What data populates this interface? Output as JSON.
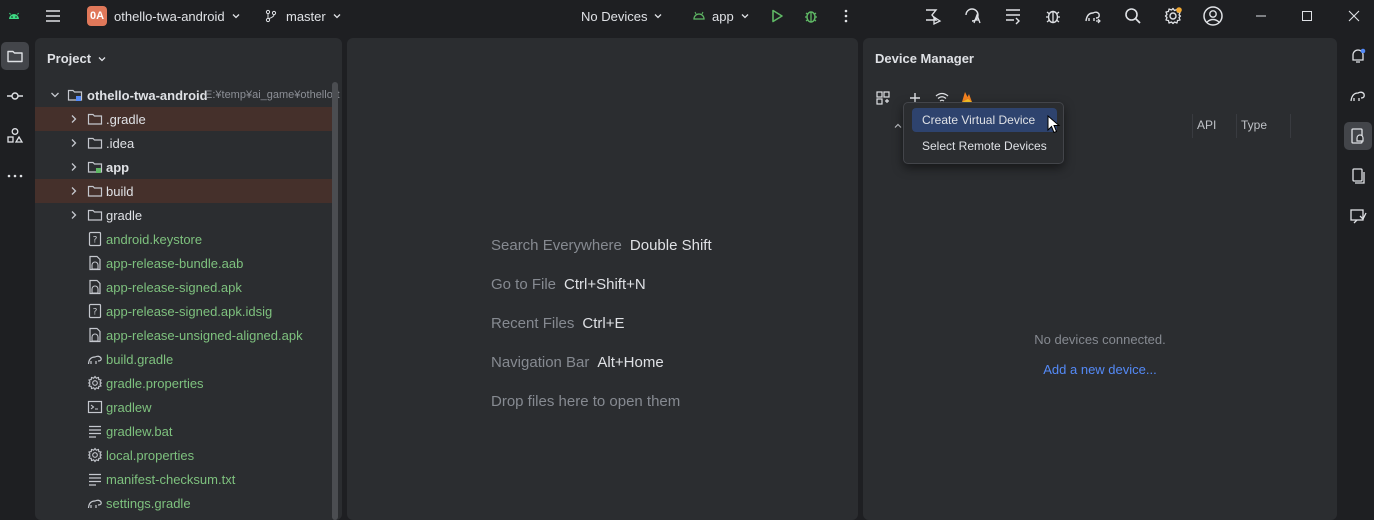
{
  "titlebar": {
    "project_badge": "0A",
    "project_name": "othello-twa-android",
    "branch": "master",
    "device_selector": "No Devices",
    "run_config": "app"
  },
  "project_panel": {
    "title": "Project",
    "root": {
      "name": "othello-twa-android",
      "path": "E:¥temp¥ai_game¥othello-t"
    },
    "items": [
      {
        "name": ".gradle",
        "kind": "folder",
        "expandable": true,
        "highlight": true,
        "style": "white"
      },
      {
        "name": ".idea",
        "kind": "folder",
        "expandable": true,
        "highlight": false,
        "style": "white"
      },
      {
        "name": "app",
        "kind": "module",
        "expandable": true,
        "highlight": false,
        "style": "bold"
      },
      {
        "name": "build",
        "kind": "folder",
        "expandable": true,
        "highlight": true,
        "style": "white"
      },
      {
        "name": "gradle",
        "kind": "folder",
        "expandable": true,
        "highlight": false,
        "style": "white"
      },
      {
        "name": "android.keystore",
        "kind": "unknown-file",
        "expandable": false,
        "highlight": false,
        "style": "green"
      },
      {
        "name": "app-release-bundle.aab",
        "kind": "archive-file",
        "expandable": false,
        "highlight": false,
        "style": "green"
      },
      {
        "name": "app-release-signed.apk",
        "kind": "archive-file",
        "expandable": false,
        "highlight": false,
        "style": "green"
      },
      {
        "name": "app-release-signed.apk.idsig",
        "kind": "unknown-file",
        "expandable": false,
        "highlight": false,
        "style": "green"
      },
      {
        "name": "app-release-unsigned-aligned.apk",
        "kind": "archive-file",
        "expandable": false,
        "highlight": false,
        "style": "green"
      },
      {
        "name": "build.gradle",
        "kind": "gradle-file",
        "expandable": false,
        "highlight": false,
        "style": "green"
      },
      {
        "name": "gradle.properties",
        "kind": "settings-file",
        "expandable": false,
        "highlight": false,
        "style": "green"
      },
      {
        "name": "gradlew",
        "kind": "terminal-file",
        "expandable": false,
        "highlight": false,
        "style": "green"
      },
      {
        "name": "gradlew.bat",
        "kind": "text-file",
        "expandable": false,
        "highlight": false,
        "style": "green"
      },
      {
        "name": "local.properties",
        "kind": "settings-file",
        "expandable": false,
        "highlight": false,
        "style": "green"
      },
      {
        "name": "manifest-checksum.txt",
        "kind": "text-file",
        "expandable": false,
        "highlight": false,
        "style": "green"
      },
      {
        "name": "settings.gradle",
        "kind": "gradle-file",
        "expandable": false,
        "highlight": false,
        "style": "green"
      }
    ]
  },
  "editor": {
    "hints": [
      {
        "label": "Search Everywhere",
        "key": "Double Shift"
      },
      {
        "label": "Go to File",
        "key": "Ctrl+Shift+N"
      },
      {
        "label": "Recent Files",
        "key": "Ctrl+E"
      },
      {
        "label": "Navigation Bar",
        "key": "Alt+Home"
      },
      {
        "label": "Drop files here to open them",
        "key": ""
      }
    ]
  },
  "device_manager": {
    "title": "Device Manager",
    "columns": {
      "api": "API",
      "type": "Type"
    },
    "empty_message": "No devices connected.",
    "add_link": "Add a new device...",
    "dropdown": [
      {
        "label": "Create Virtual Device",
        "selected": true
      },
      {
        "label": "Select Remote Devices",
        "selected": false
      }
    ]
  },
  "colors": {
    "background": "#1e1f22",
    "panel": "#2b2d30",
    "accent_green": "#5fb865",
    "link_blue": "#548af7",
    "selection": "#2e436e",
    "vcs_green_text": "#7ec17e"
  },
  "icons": {
    "left_strip": [
      "android-icon",
      "project-folder-icon",
      "commit-icon",
      "structure-icon",
      "more-icon"
    ],
    "right_strip": [
      "notifications-icon",
      "gradle-icon",
      "device-manager-icon",
      "running-devices-icon",
      "app-quality-icon"
    ]
  }
}
